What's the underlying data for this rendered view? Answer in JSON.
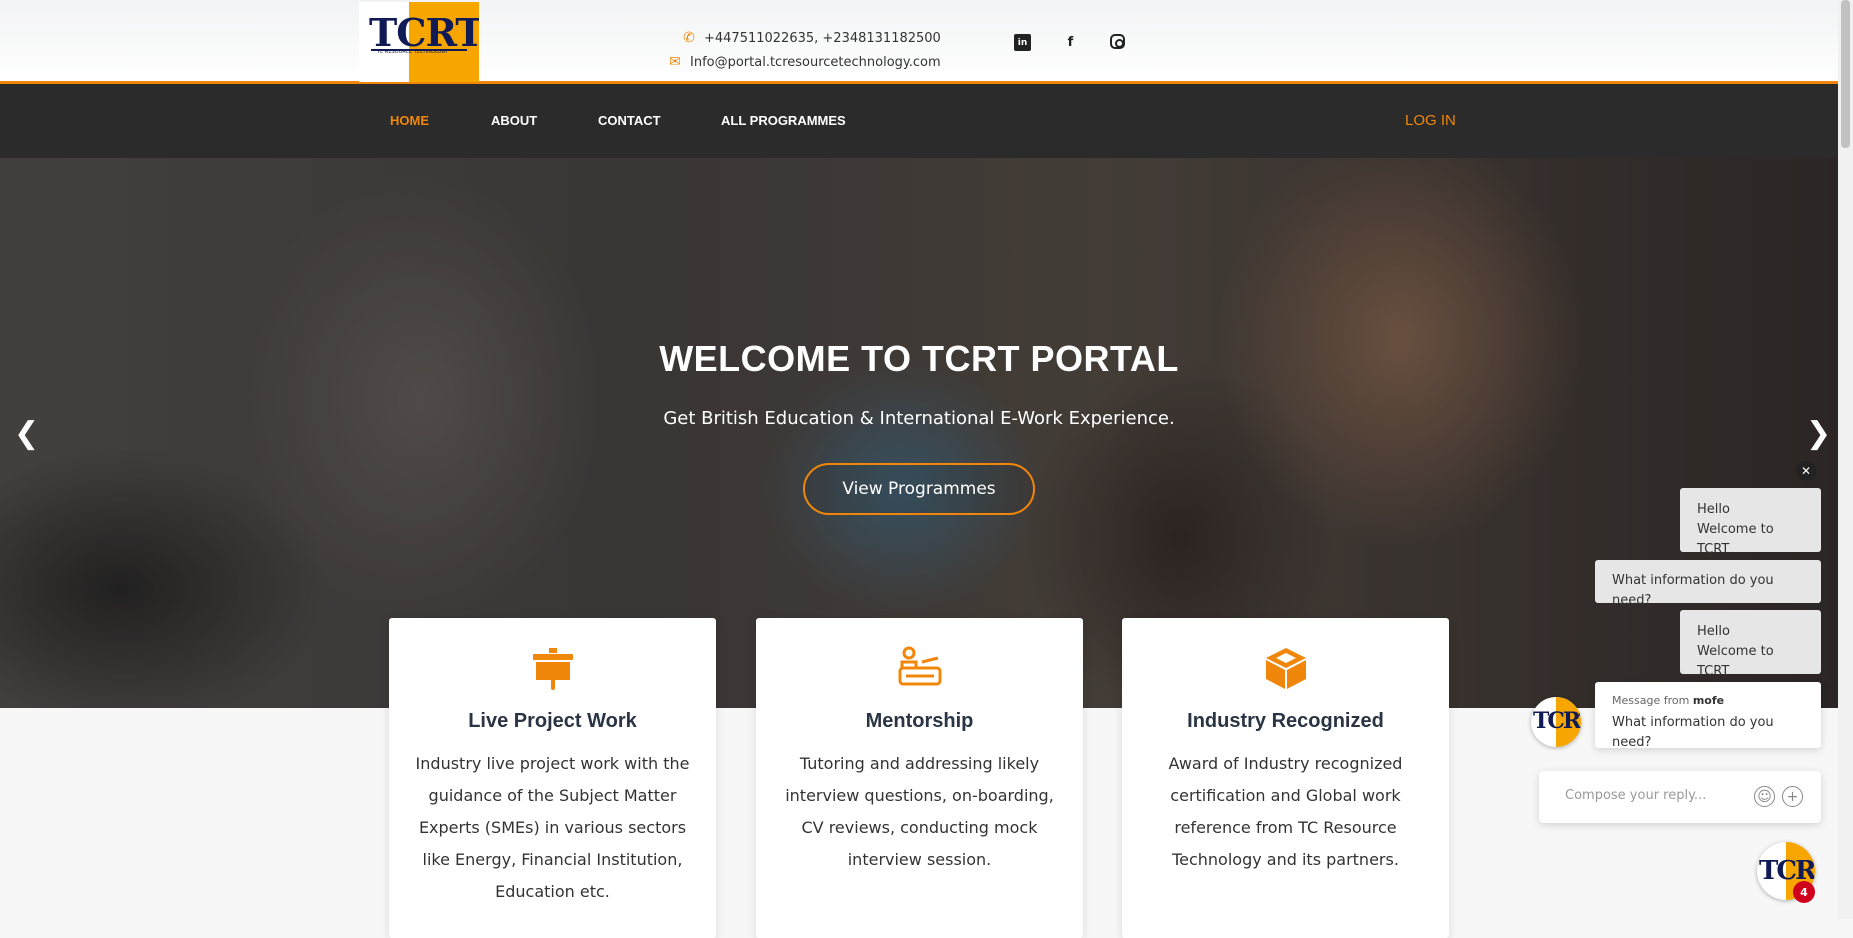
{
  "header": {
    "logo": {
      "text": "TCRT",
      "tagline": "TC RESOURCE TECHNOLOGY"
    },
    "phone": "+447511022635, +2348131182500",
    "email": "Info@portal.tcresourcetechnology.com",
    "social": [
      "linkedin-icon",
      "facebook-icon",
      "instagram-icon"
    ]
  },
  "nav": {
    "items": [
      {
        "label": "HOME",
        "active": true
      },
      {
        "label": "ABOUT"
      },
      {
        "label": "CONTACT"
      },
      {
        "label": "ALL PROGRAMMES"
      }
    ],
    "login": "LOG IN"
  },
  "hero": {
    "title": "WELCOME TO TCRT PORTAL",
    "subtitle": "Get British Education & International E-Work Experience.",
    "cta": "View Programmes"
  },
  "cards": [
    {
      "icon": "presentation-board-icon",
      "title": "Live Project Work",
      "text": "Industry live project work with the guidance of the Subject Matter Experts (SMEs) in various sectors like Energy, Financial Institution, Education etc."
    },
    {
      "icon": "mentorship-icon",
      "title": "Mentorship",
      "text": "Tutoring and addressing likely interview questions, on-boarding, CV reviews, conducting mock interview session."
    },
    {
      "icon": "box-icon",
      "title": "Industry Recognized",
      "text": "Award of Industry recognized certification and Global work reference from TC Resource Technology and its partners."
    }
  ],
  "chat": {
    "messages": [
      {
        "line1": "Hello",
        "line2": "Welcome to TCRT"
      },
      {
        "line1": "What information do you need?"
      },
      {
        "line1": "Hello",
        "line2": "Welcome to TCRT"
      },
      {
        "from_label": "Message from",
        "from_name": "mofe",
        "line1": "What information do you need?"
      }
    ],
    "compose_placeholder": "Compose your reply...",
    "unread_count": "4",
    "avatar_text": "TCRT"
  },
  "colors": {
    "accent": "#f0870a",
    "nav_bg": "#2b2b2b",
    "brand_navy": "#101a55"
  }
}
